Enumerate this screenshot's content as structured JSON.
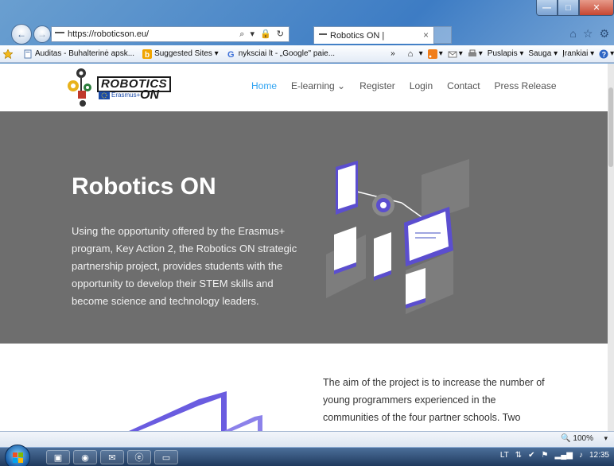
{
  "browser": {
    "address": "https://roboticson.eu/",
    "address_tools": "⌕ ▾ 🔒 ↻",
    "tab_title": "Robotics ON |",
    "tab_close": "×",
    "back_glyph": "←",
    "forward_glyph": "→",
    "window_buttons": {
      "minimize": "—",
      "maximize": "□",
      "close": "✕"
    },
    "right_icons": [
      "home-icon",
      "favorites-star-icon",
      "tools-gear-icon"
    ]
  },
  "favorites_bar": {
    "items": [
      {
        "label": "Auditas - Buhalterinė apsk...",
        "icon": "page-icon"
      },
      {
        "label": "Suggested Sites ▾",
        "icon": "bing-icon"
      },
      {
        "label": "nyksciai lt - „Google\" paie...",
        "icon": "google-icon"
      }
    ],
    "overflow": "»",
    "commands": [
      {
        "label": "▾",
        "icon": "home-icon"
      },
      {
        "label": "▾",
        "icon": "rss-icon"
      },
      {
        "label": "▾",
        "icon": "mail-icon"
      },
      {
        "label": "▾",
        "icon": "print-icon"
      },
      {
        "label": "Puslapis ▾",
        "icon": ""
      },
      {
        "label": "Sauga ▾",
        "icon": ""
      },
      {
        "label": "Įrankiai ▾",
        "icon": ""
      },
      {
        "label": "▾",
        "icon": "help-icon"
      }
    ]
  },
  "site": {
    "logo": {
      "word1": "ROBOTICS",
      "word2": "Erasmus+",
      "word3": "ON"
    },
    "nav": [
      "Home",
      "E-learning ⌄",
      "Register",
      "Login",
      "Contact",
      "Press Release"
    ],
    "active_nav": "Home",
    "hero": {
      "title": "Robotics ON",
      "text": "Using the opportunity offered by the Erasmus+ program, Key Action 2, the Robotics ON strategic partnership project, provides students with the opportunity to develop their STEM skills and become science and technology leaders."
    },
    "section2": {
      "text": "The aim of the project is to increase the number of young programmers experienced in the communities of the four partner schools. Two"
    }
  },
  "status": {
    "zoom": "100%",
    "zoom_drop": "▾"
  },
  "taskbar": {
    "apps": [
      "explorer-icon",
      "chrome-icon",
      "outlook-icon",
      "ie-icon",
      "window-icon"
    ],
    "tray_lang": "LT",
    "time": "12:35"
  },
  "colors": {
    "accent": "#2ea3f2",
    "hero_bg": "#6e6e6e",
    "taskbar": "#1f3a5e"
  }
}
